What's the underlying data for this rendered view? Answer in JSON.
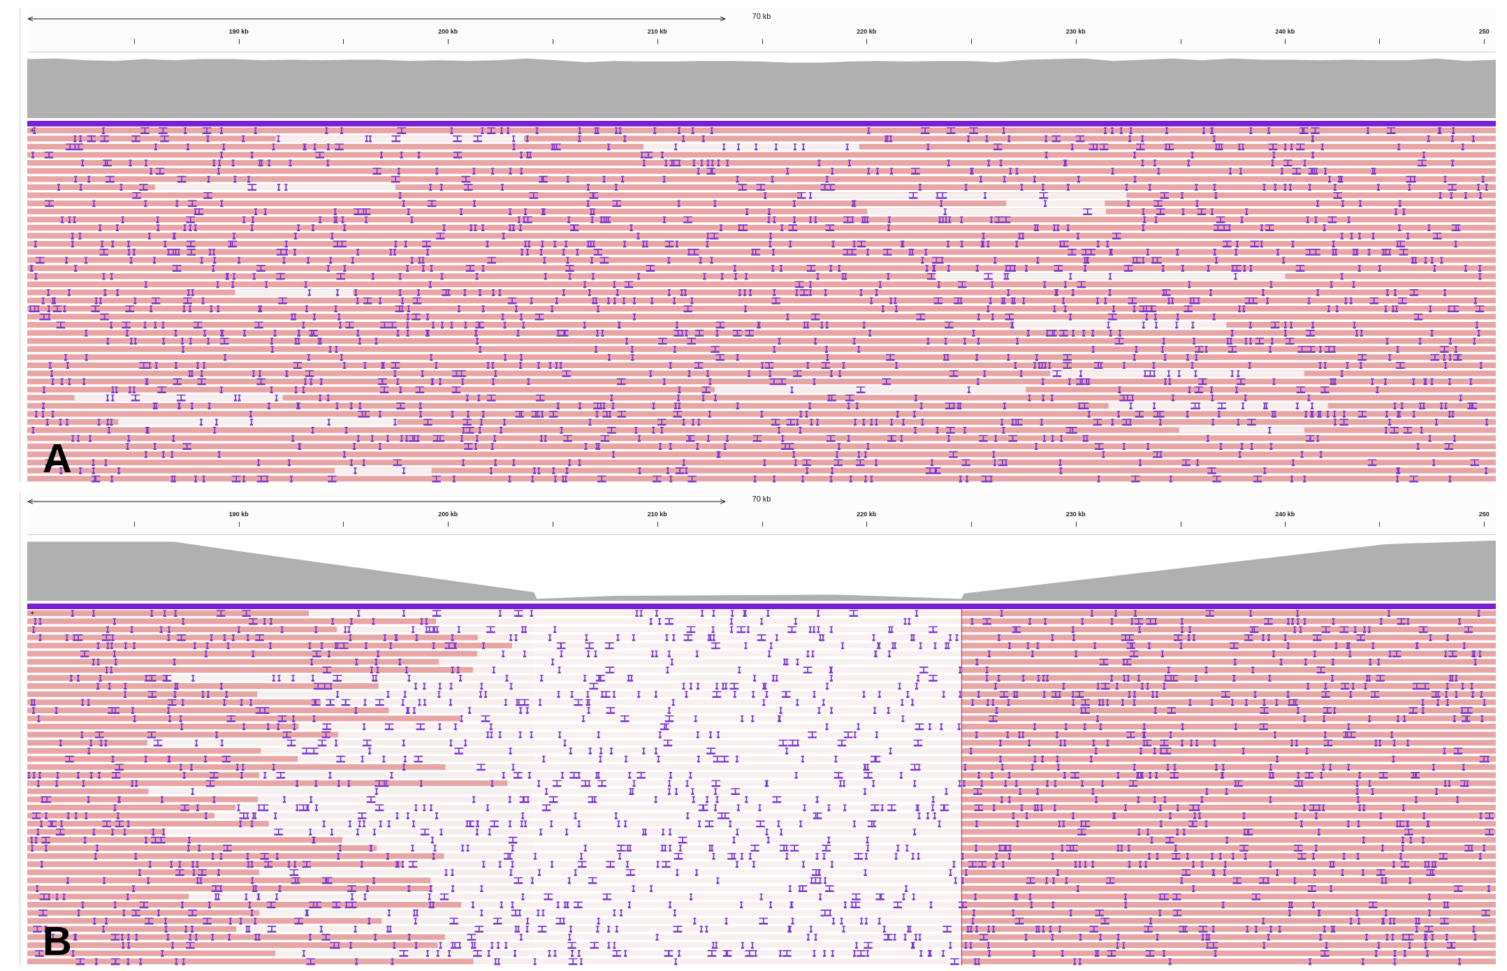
{
  "panels": [
    {
      "label": "A",
      "ruler": {
        "span": "70 kb",
        "ticks": [
          "190 kb",
          "200 kb",
          "210 kb",
          "220 kb",
          "230 kb",
          "240 kb",
          "250"
        ]
      },
      "coverage": {
        "kind": "flat"
      },
      "alignments": {
        "toggle": "+",
        "kind": "uniform"
      }
    },
    {
      "label": "B",
      "ruler": {
        "span": "70 kb",
        "ticks": [
          "190 kb",
          "200 kb",
          "210 kb",
          "220 kb",
          "230 kb",
          "240 kb",
          "250"
        ]
      },
      "coverage": {
        "kind": "dip"
      },
      "alignments": {
        "toggle": "+",
        "kind": "split"
      }
    }
  ]
}
